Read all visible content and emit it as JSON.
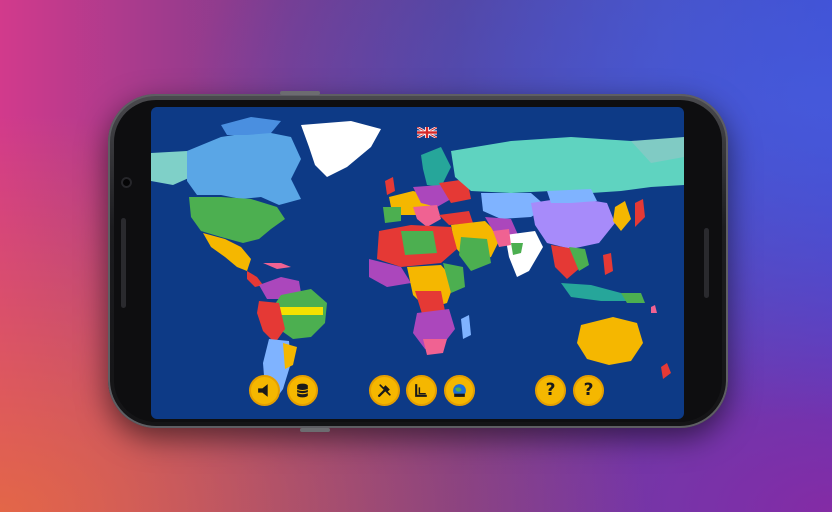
{
  "app": {
    "title": ""
  },
  "colors": {
    "ocean": "#0d3a86",
    "button_fill": "#f5b700",
    "button_border": "#e59f00",
    "icon_dark": "#1a1a1a"
  },
  "toolbar": {
    "buttons": [
      {
        "id": "sound",
        "icon": "speaker-icon",
        "label": ""
      },
      {
        "id": "database",
        "icon": "database-icon",
        "label": ""
      },
      {
        "id": "tools",
        "icon": "tools-icon",
        "label": ""
      },
      {
        "id": "book",
        "icon": "book-icon",
        "label": ""
      },
      {
        "id": "globe",
        "icon": "globe-icon",
        "label": ""
      },
      {
        "id": "help1",
        "icon": "help-icon",
        "label": "?"
      },
      {
        "id": "help2",
        "icon": "help-icon",
        "label": "?"
      }
    ]
  }
}
